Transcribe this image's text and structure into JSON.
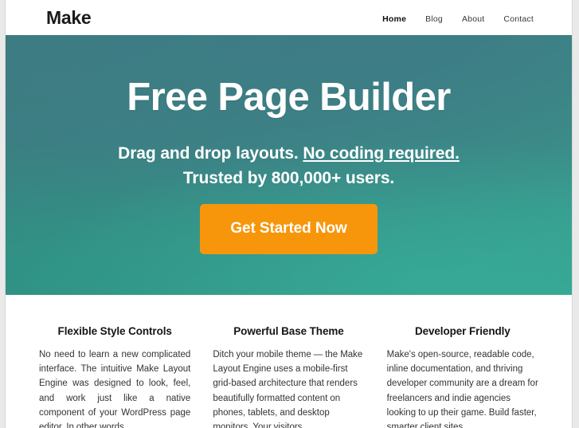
{
  "site": {
    "logo": "Make"
  },
  "nav": {
    "items": [
      {
        "label": "Home",
        "active": true
      },
      {
        "label": "Blog",
        "active": false
      },
      {
        "label": "About",
        "active": false
      },
      {
        "label": "Contact",
        "active": false
      }
    ]
  },
  "hero": {
    "title": "Free Page Builder",
    "subtitle_line1_plain": "Drag and drop layouts. ",
    "subtitle_line1_underlined": "No coding required.",
    "subtitle_line2": "Trusted by 800,000+ users.",
    "cta_label": "Get Started Now",
    "cta_color": "#f7960b",
    "background_colors": [
      "#3d7b80",
      "#3b8183",
      "#3a9189",
      "#3aa395"
    ]
  },
  "features": [
    {
      "title": "Flexible Style Controls",
      "body": "No need to learn a new complicated interface. The intuitive Make Layout Engine was designed to look, feel, and work just like a native component of your WordPress page editor. In other words,"
    },
    {
      "title": "Powerful Base Theme",
      "body": "Ditch your mobile theme — the Make Layout Engine uses a mobile-first grid-based architecture that renders beautifully formatted content on phones, tablets, and desktop monitors. Your visitors"
    },
    {
      "title": "Developer Friendly",
      "body": "Make's open-source, readable code, inline documentation, and thriving developer community are a dream for freelancers and indie agencies looking to up their game. Build faster, smarter client sites"
    }
  ]
}
